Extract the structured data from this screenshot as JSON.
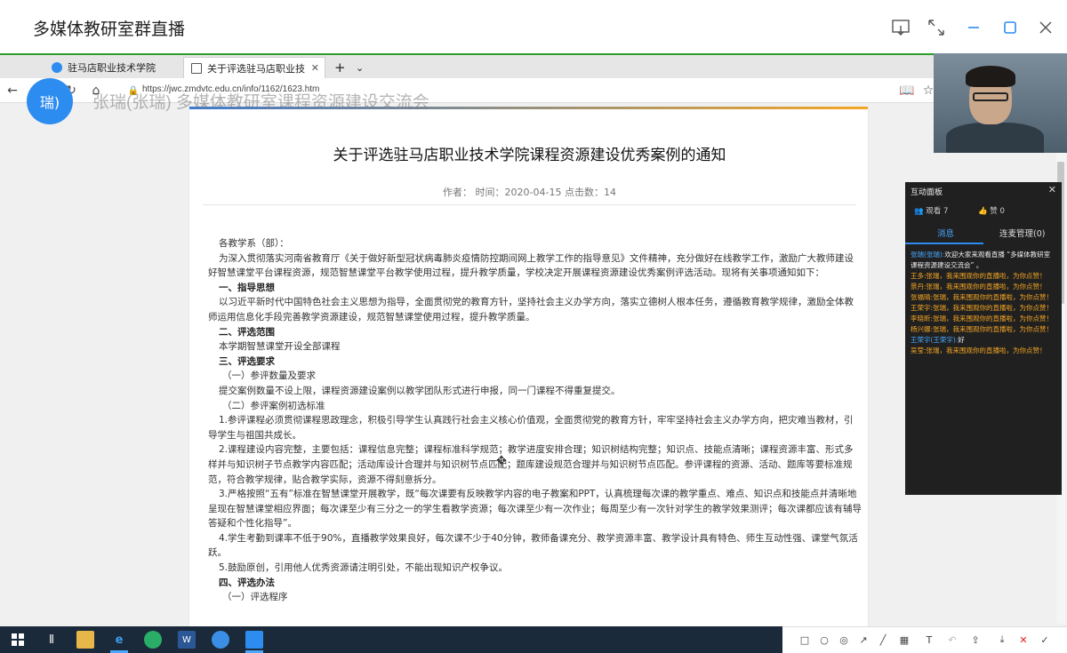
{
  "window": {
    "title": "多媒体教研室群直播"
  },
  "browser": {
    "tabs": [
      {
        "label": "驻马店职业技术学院",
        "active": false
      },
      {
        "label": "关于评选驻马店职业技",
        "active": true
      }
    ],
    "new_tab_label": "+",
    "url": "https://jwc.zmdvtc.edu.cn/info/1162/1623.htm"
  },
  "speaker": {
    "avatar_text": "瑞)",
    "overlay": "张瑞(张瑞) 多媒体教研室课程资源建设交流会"
  },
  "article": {
    "title": "关于评选驻马店职业技术学院课程资源建设优秀案例的通知",
    "meta": "作者：  时间：2020-04-15 点击数：14",
    "paragraphs": [
      {
        "style": "indent",
        "text": "各教学系（部）："
      },
      {
        "style": "indent",
        "text": "为深入贯彻落实河南省教育厅《关于做好新型冠状病毒肺炎疫情防控期间网上教学工作的指导意见》文件精神，充分做好在线教学工作，激励广大教师建设好智慧课堂平台课程资源，规范智慧课堂平台教学使用过程，提升教学质量，学校决定开展课程资源建设优秀案例评选活动。现将有关事项通知如下："
      },
      {
        "style": "h",
        "text": "一、指导思想"
      },
      {
        "style": "indent",
        "text": "以习近平新时代中国特色社会主义思想为指导，全面贯彻党的教育方针，坚持社会主义办学方向，落实立德树人根本任务，遵循教育教学规律，激励全体教师运用信息化手段完善教学资源建设，规范智慧课堂使用过程，提升教学质量。"
      },
      {
        "style": "h",
        "text": "二、评选范围"
      },
      {
        "style": "indent",
        "text": "本学期智慧课堂开设全部课程"
      },
      {
        "style": "h",
        "text": "三、评选要求"
      },
      {
        "style": "sub",
        "text": "（一）参评数量及要求"
      },
      {
        "style": "indent",
        "text": "提交案例数量不设上限，课程资源建设案例以教学团队形式进行申报，同一门课程不得重复提交。"
      },
      {
        "style": "sub",
        "text": "（二）参评案例初选标准"
      },
      {
        "style": "indent",
        "text": "1.参评课程必须贯彻课程思政理念，积极引导学生认真践行社会主义核心价值观，全面贯彻党的教育方针，牢牢坚持社会主义办学方向，把灾难当教材，引导学生与祖国共成长。"
      },
      {
        "style": "indent",
        "text": "2.课程建设内容完整，主要包括：课程信息完整；课程标准科学规范；教学进度安排合理；知识树结构完整；知识点、技能点清晰；课程资源丰富、形式多样并与知识树子节点教学内容匹配；活动库设计合理并与知识树节点匹配；题库建设规范合理并与知识树节点匹配。参评课程的资源、活动、题库等要标准规范，符合教学规律，贴合教学实际，资源不得刻意拆分。"
      },
      {
        "style": "indent",
        "text": "3.严格按照“五有”标准在智慧课堂开展教学，既“每次课要有反映教学内容的电子教案和PPT，认真梳理每次课的教学重点、难点、知识点和技能点并清晰地呈现在智慧课堂相应界面；每次课至少有三分之一的学生看教学资源；每次课至少有一次作业；每周至少有一次针对学生的教学效果测评；每次课都应该有辅导答疑和个性化指导”。"
      },
      {
        "style": "indent",
        "text": "4.学生考勤到课率不低于90%，直播教学效果良好，每次课不少于40分钟，教师备课充分、教学资源丰富、教学设计具有特色、师生互动性强、课堂气氛活跃。"
      },
      {
        "style": "indent",
        "text": "5.鼓励原创，引用他人优秀资源请注明引处，不能出现知识产权争议。"
      },
      {
        "style": "h",
        "text": "四、评选办法"
      },
      {
        "style": "sub",
        "text": "（一）评选程序"
      }
    ]
  },
  "panel": {
    "title": "互动面板",
    "viewers": "观看 7",
    "likes": "赞 0",
    "tabs": [
      "消息",
      "连麦管理(0)"
    ],
    "messages": [
      {
        "sender": "张瑞(张瑞):",
        "text": "欢迎大家来观看直播 “多媒体教研室课程资源建设交流会” 。",
        "sender_color": "blue",
        "text_color": "white"
      },
      {
        "sender": "王多:",
        "text": "张瑞，我来围观你的直播啦，为你点赞！",
        "sender_color": "orange",
        "text_color": "orange"
      },
      {
        "sender": "景丹:",
        "text": "张瑞，我来围观你的直播啦，为你点赞！",
        "sender_color": "orange",
        "text_color": "orange"
      },
      {
        "sender": "张福晴:",
        "text": "张瑞，我来围观你的直播啦，为你点赞！",
        "sender_color": "orange",
        "text_color": "orange"
      },
      {
        "sender": "王荣宇:",
        "text": "张瑞，我来围观你的直播啦，为你点赞！",
        "sender_color": "orange",
        "text_color": "orange"
      },
      {
        "sender": "李晓昕:",
        "text": "张瑞，我来围观你的直播啦，为你点赞！",
        "sender_color": "orange",
        "text_color": "orange"
      },
      {
        "sender": "杨兴娜:",
        "text": "张瑞，我来围观你的直播啦，为你点赞！",
        "sender_color": "orange",
        "text_color": "orange"
      },
      {
        "sender": "王荣宇(王荣宇):",
        "text": "好",
        "sender_color": "blue",
        "text_color": "white"
      },
      {
        "sender": "吴莹:",
        "text": "张瑞，我来围观你的直播啦，为你点赞！",
        "sender_color": "orange",
        "text_color": "orange"
      }
    ]
  },
  "colors": {
    "accent": "#2d8cf0",
    "chat_orange": "#f5a623",
    "taskbar": "#1b2a3a"
  },
  "icons": {
    "window_controls": [
      "cast-icon",
      "expand-icon",
      "minimize-icon",
      "maximize-icon",
      "close-icon"
    ],
    "nav": [
      "back-icon",
      "refresh-icon",
      "home-icon",
      "lock-icon",
      "reader-icon",
      "favorite-icon"
    ],
    "taskbar": [
      "windows-start-icon",
      "task-view-icon",
      "file-explorer-icon",
      "edge-icon",
      "wechat-icon",
      "word-icon",
      "app-blue-icon",
      "app-screen-icon"
    ],
    "draw_tools": [
      "rectangle-icon",
      "circle-icon",
      "pen-icon",
      "arrow-icon",
      "line-icon",
      "mosaic-icon",
      "text-icon",
      "undo-icon",
      "share-icon",
      "download-icon",
      "clear-icon",
      "confirm-icon"
    ]
  }
}
